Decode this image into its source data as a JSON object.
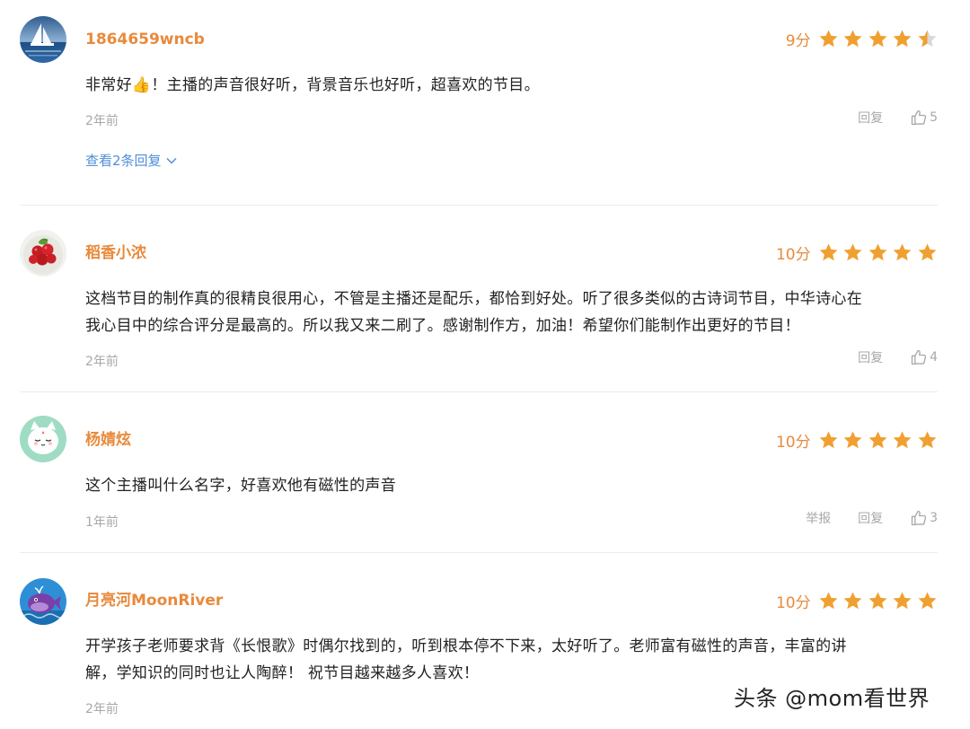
{
  "colors": {
    "username": "#e88a3c",
    "score": "#e88a3c",
    "star_filled": "#f0a031",
    "star_empty": "#d8d8d8",
    "meta": "#a8a8a8",
    "link": "#4f8ed8",
    "divider": "#ececec"
  },
  "reviews": [
    {
      "username": "1864659wncb",
      "score": "9分",
      "rating_stars": 4.5,
      "content_before_emoji": "非常好",
      "emoji": "👍",
      "content_after_emoji": "！主播的声音很好听，背景音乐也好听，超喜欢的节目。",
      "time": "2年前",
      "reply_label": "回复",
      "likes": "5",
      "view_replies": "查看2条回复",
      "avatar_icon": "sailboat-avatar"
    },
    {
      "username": "稻香小浓",
      "score": "10分",
      "rating_stars": 5,
      "content_line1": "这档节目的制作真的很精良很用心，不管是主播还是配乐，都恰到好处。听了很多类似的古诗词节目，中华诗心在",
      "content_line2": "我心目中的综合评分是最高的。所以我又来二刷了。感谢制作方，加油！希望你们能制作出更好的节目！",
      "time": "2年前",
      "reply_label": "回复",
      "likes": "4",
      "avatar_icon": "berries-avatar"
    },
    {
      "username": "杨婧炫",
      "score": "10分",
      "rating_stars": 5,
      "content": "这个主播叫什么名字，好喜欢他有磁性的声音",
      "time": "1年前",
      "report_label": "举报",
      "reply_label": "回复",
      "likes": "3",
      "avatar_icon": "cat-avatar"
    },
    {
      "username": "月亮河MoonRiver",
      "score": "10分",
      "rating_stars": 5,
      "content_line1": "开学孩子老师要求背《长恨歌》时偶尔找到的，听到根本停不下来，太好听了。老师富有磁性的声音，丰富的讲",
      "content_line2": "解，学知识的同时也让人陶醉！ 祝节目越来越多人喜欢！",
      "time": "2年前",
      "avatar_icon": "whale-avatar"
    }
  ],
  "watermark": "头条 @mom看世界"
}
